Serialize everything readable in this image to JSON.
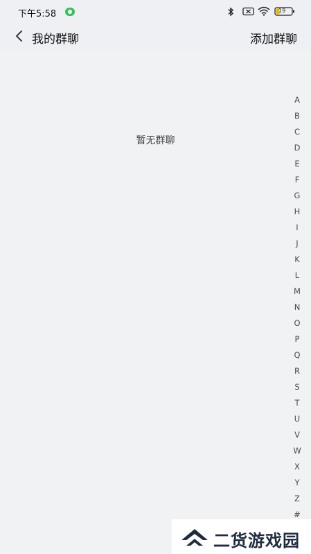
{
  "status_bar": {
    "time": "下午5:58",
    "battery": "19"
  },
  "header": {
    "title": "我的群聊",
    "action_label": "添加群聊"
  },
  "main": {
    "empty_message": "暂无群聊"
  },
  "alpha_index": [
    "A",
    "B",
    "C",
    "D",
    "E",
    "F",
    "G",
    "H",
    "I",
    "J",
    "K",
    "L",
    "M",
    "N",
    "O",
    "P",
    "Q",
    "R",
    "S",
    "T",
    "U",
    "V",
    "W",
    "X",
    "Y",
    "Z",
    "#"
  ],
  "watermark": {
    "text": "二货游戏园"
  },
  "colors": {
    "background": "#f1f2f4",
    "header": "#eef0f4",
    "status_indicator": "#35c25a",
    "watermark_text": "#1f2c40"
  }
}
